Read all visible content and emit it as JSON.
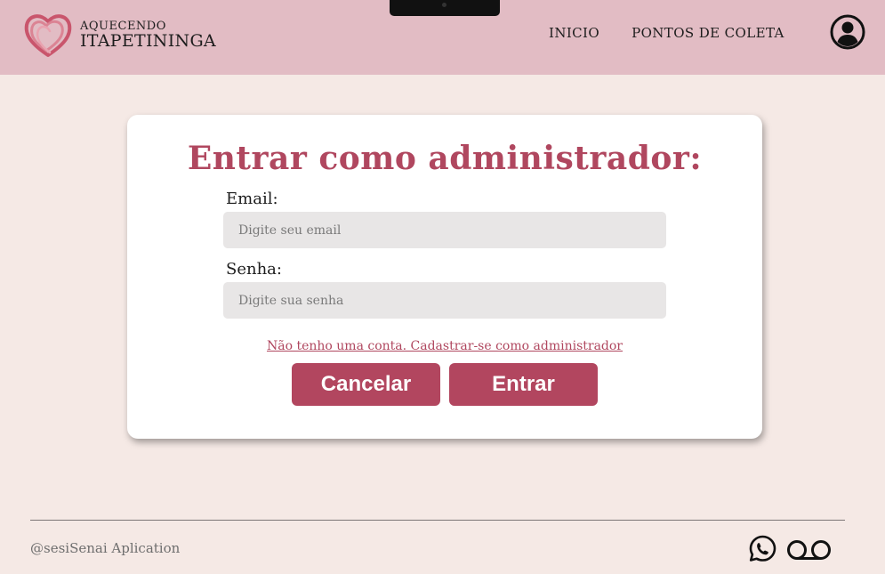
{
  "header": {
    "logo_line1": "AQUECENDO",
    "logo_line2": "ITAPETININGA",
    "nav": [
      "INICIO",
      "PONTOS DE COLETA"
    ],
    "user_icon": "user-circle-icon",
    "bg_color": "#e2bcc4"
  },
  "login": {
    "title": "Entrar como administrador:",
    "email_label": "Email:",
    "email_placeholder": "Digite seu email",
    "password_label": "Senha:",
    "password_placeholder": "Digite sua senha",
    "register_link": "Não tenho uma conta. Cadastrar-se como administrador",
    "cancel_button": "Cancelar",
    "enter_button": "Entrar",
    "accent_color": "#b2465f"
  },
  "footer": {
    "credit": "@sesiSenai Aplication",
    "icons": [
      "whatsapp-icon",
      "voicemail-icon"
    ]
  }
}
